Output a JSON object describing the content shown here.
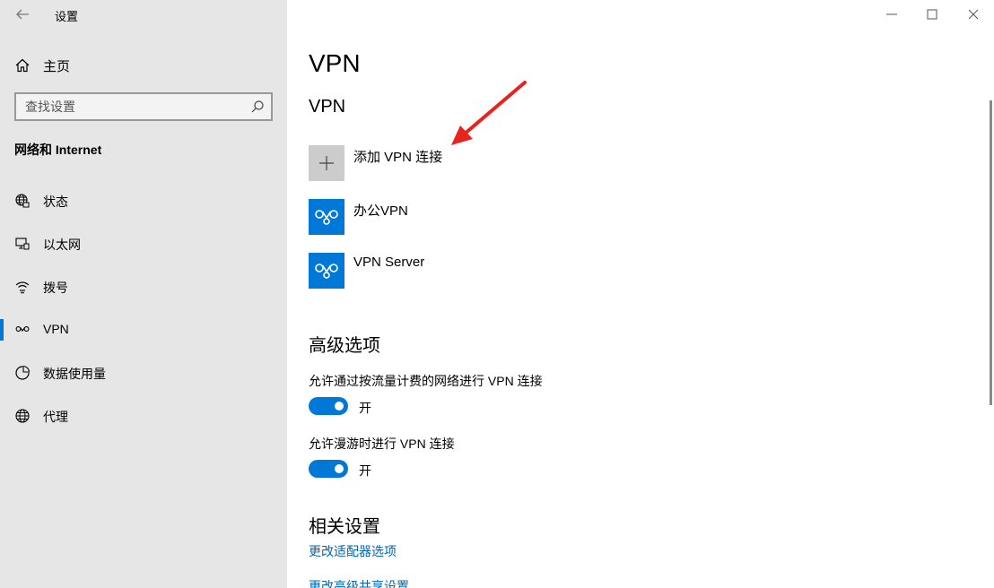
{
  "window": {
    "title": "设置",
    "accent": "#0078d7"
  },
  "sidebar": {
    "home_label": "主页",
    "search_placeholder": "查找设置",
    "section_title": "网络和 Internet",
    "items": [
      {
        "label": "状态",
        "icon": "globe-status-icon",
        "selected": false
      },
      {
        "label": "以太网",
        "icon": "ethernet-icon",
        "selected": false
      },
      {
        "label": "拨号",
        "icon": "dialup-icon",
        "selected": false
      },
      {
        "label": "VPN",
        "icon": "vpn-icon",
        "selected": true
      },
      {
        "label": "数据使用量",
        "icon": "data-usage-icon",
        "selected": false
      },
      {
        "label": "代理",
        "icon": "proxy-globe-icon",
        "selected": false
      }
    ]
  },
  "main": {
    "page_title": "VPN",
    "vpn_section_title": "VPN",
    "add_vpn_label": "添加 VPN 连接",
    "connections": [
      {
        "name": "办公VPN"
      },
      {
        "name": "VPN Server"
      }
    ],
    "advanced": {
      "title": "高级选项",
      "options": [
        {
          "label": "允许通过按流量计费的网络进行 VPN 连接",
          "state": "开",
          "on": true
        },
        {
          "label": "允许漫游时进行 VPN 连接",
          "state": "开",
          "on": true
        }
      ]
    },
    "related": {
      "title": "相关设置",
      "links": [
        "更改适配器选项",
        "更改高级共享设置"
      ]
    }
  },
  "annotation": {
    "arrow_color": "#e8231d"
  }
}
